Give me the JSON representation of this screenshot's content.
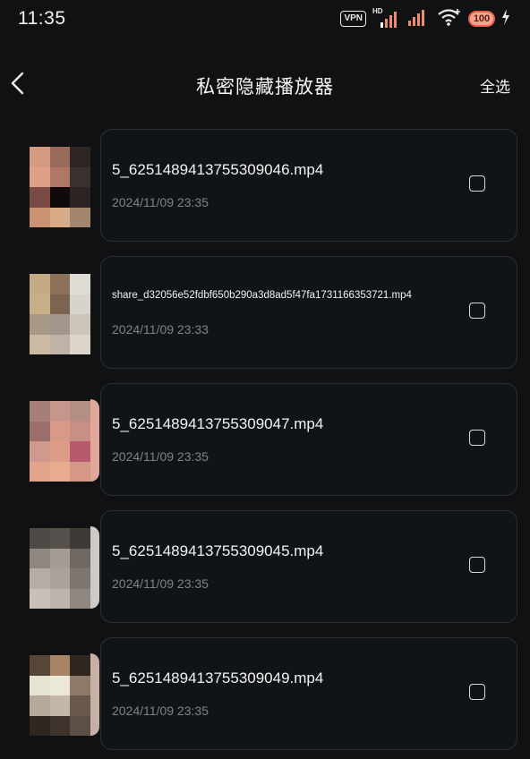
{
  "status_bar": {
    "time": "11:35",
    "vpn": "VPN",
    "hd": "HD",
    "battery": "100"
  },
  "header": {
    "title": "私密隐藏播放器",
    "select_all": "全选"
  },
  "videos": [
    {
      "name": "5_6251489413755309046.mp4",
      "date": "2024/11/09 23:35",
      "checked": false,
      "thumb_colors": [
        "#d59a82",
        "#9a6a5c",
        "#2f2624",
        "#dfa089",
        "#b07764",
        "#3a302d",
        "#7a4a44",
        "#100a0b",
        "#2c2422",
        "#c99374",
        "#d8aa86",
        "#a38670"
      ]
    },
    {
      "name": "share_d32056e52fdbf650b290a3d8ad5f47fa1731166353721.mp4",
      "date": "2024/11/09 23:33",
      "checked": false,
      "thumb_colors": [
        "#c4ab84",
        "#8b7158",
        "#dedad4",
        "#c7ae86",
        "#7d6450",
        "#d8d3cb",
        "#a89886",
        "#a3968c",
        "#cdc4ba",
        "#cbb9a3",
        "#bfb3a7",
        "#dcd5cc"
      ]
    },
    {
      "name": "5_6251489413755309047.mp4",
      "date": "2024/11/09 23:35",
      "checked": false,
      "thumb_colors": [
        "#a57f78",
        "#c6958b",
        "#b38f86",
        "#9b6f69",
        "#d89a87",
        "#c88f84",
        "#d19890",
        "#dd9c86",
        "#b8596e",
        "#e1a58c",
        "#e7ac8f",
        "#d69886"
      ]
    },
    {
      "name": "5_6251489413755309045.mp4",
      "date": "2024/11/09 23:35",
      "checked": false,
      "thumb_colors": [
        "#4e4a45",
        "#55504b",
        "#3e3a36",
        "#8e8781",
        "#a49c95",
        "#6f6862",
        "#b5ada6",
        "#aaa29b",
        "#7d7670",
        "#c8c0b9",
        "#bdb5ae",
        "#8f8881"
      ]
    },
    {
      "name": "5_6251489413755309049.mp4",
      "date": "2024/11/09 23:35",
      "checked": false,
      "thumb_colors": [
        "#574536",
        "#a68465",
        "#2f2621",
        "#e7e3d3",
        "#ece8d8",
        "#8d7a69",
        "#b7a99a",
        "#c4b7a9",
        "#6a5a4e",
        "#2e2621",
        "#3f342d",
        "#5e4f45"
      ]
    }
  ],
  "colors": {
    "background": "#0f1113",
    "card_border": "#2b2f33",
    "text_primary": "#f2f2f2",
    "text_secondary": "#7e8389"
  }
}
